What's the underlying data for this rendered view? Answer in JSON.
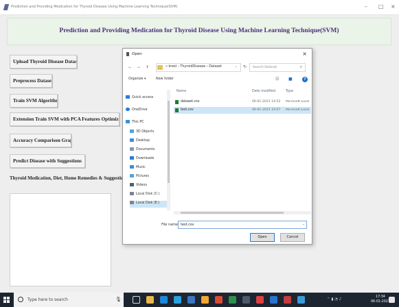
{
  "window": {
    "title": "Prediction and Providing Medication for Thyroid Disease Using Machine Learning Technique(SVM)",
    "controls": [
      "–",
      "□",
      "×"
    ]
  },
  "header": {
    "title": "Prediction and Providing Medication for Thyroid Disease Using Machine Learning Technique(SVM)"
  },
  "buttons": [
    "Upload Thyroid Disease Dataset",
    "Preprocess Dataset",
    "Train SVM Algorithm",
    "Extension Train SVM with PCA Features Optimization",
    "Accuracy Comparison Graph",
    "Predict Disease with Suggestions"
  ],
  "section_label": "Thyroid Medication, Diet, Home Remedies & Suggestion",
  "dialog": {
    "title": "Open",
    "path": "« krest › ThyroidDisease › Dataset",
    "search_placeholder": "Search Dataset",
    "organize": "Organize ▾",
    "new_folder": "New folder",
    "nav_items": [
      "Quick access",
      "OneDrive",
      "This PC",
      "3D Objects",
      "Desktop",
      "Documents",
      "Downloads",
      "Music",
      "Pictures",
      "Videos",
      "Local Disk (C:)",
      "Local Disk (E:)"
    ],
    "columns": {
      "name": "Name",
      "date": "Date modified",
      "type": "Type"
    },
    "files": [
      {
        "name": "dataset.csv",
        "date": "06-01-2021 14:52",
        "type": "Microsoft Excel C"
      },
      {
        "name": "test.csv",
        "date": "06-01-2021 16:07",
        "type": "Microsoft Excel C"
      }
    ],
    "file_name_label": "File name:",
    "file_name_value": "test.csv",
    "open_button": "Open",
    "cancel_button": "Cancel"
  },
  "taskbar": {
    "search_placeholder": "Type here to search",
    "time": "17:34",
    "date": "06-01-2021"
  },
  "colors": {
    "header_bg": "#eaf4e8",
    "header_text": "#4a2f7c",
    "taskbar_bg": "#1c2531",
    "selection": "#cde6f7"
  }
}
